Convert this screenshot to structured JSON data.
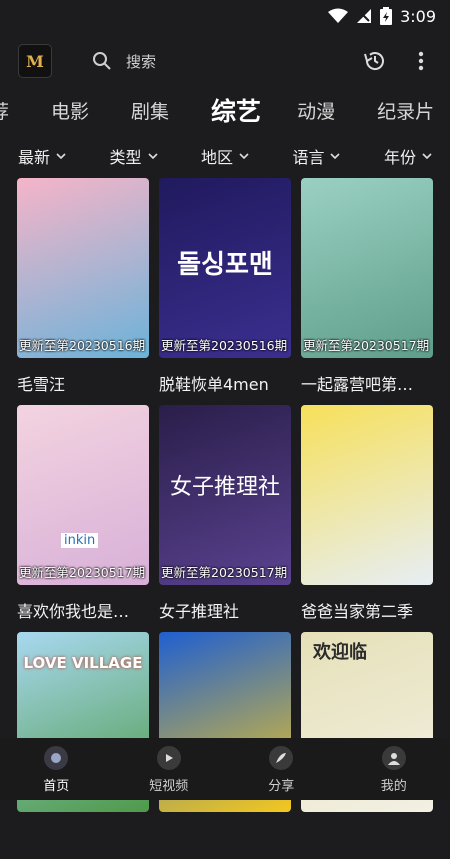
{
  "status_bar": {
    "time": "3:09"
  },
  "header": {
    "search_placeholder": "搜索",
    "logo_text": "M"
  },
  "tabs": [
    {
      "label": "荐"
    },
    {
      "label": "电影"
    },
    {
      "label": "剧集"
    },
    {
      "label": "综艺",
      "active": true
    },
    {
      "label": "动漫"
    },
    {
      "label": "纪录片"
    }
  ],
  "filters": [
    {
      "label": "最新"
    },
    {
      "label": "类型"
    },
    {
      "label": "地区"
    },
    {
      "label": "语言"
    },
    {
      "label": "年份"
    }
  ],
  "items": [
    {
      "title": "毛雪汪",
      "status": "更新至第20230516期",
      "colors": [
        "#f6b4c8",
        "#6bb3d9"
      ]
    },
    {
      "title": "脱鞋恢单4men",
      "status": "更新至第20230516期",
      "poster_text": "돌싱포맨",
      "colors": [
        "#201a5e",
        "#3b2f8f"
      ]
    },
    {
      "title": "一起露营吧第…",
      "status": "更新至第20230517期",
      "colors": [
        "#9ad0c2",
        "#5f9e8a"
      ]
    },
    {
      "title": "喜欢你我也是…",
      "status": "更新至第20230517期",
      "poster_text": "inkin",
      "colors": [
        "#f3d3e0",
        "#d8b0d8"
      ]
    },
    {
      "title": "女子推理社",
      "status": "更新至第20230517期",
      "poster_text": "女子推理社",
      "colors": [
        "#2a1e4a",
        "#5a4290"
      ]
    },
    {
      "title": "爸爸当家第二季",
      "status": "",
      "colors": [
        "#f7e05a",
        "#e6eef5"
      ]
    },
    {
      "title": "",
      "status": "",
      "poster_text": "LOVE VILLAGE",
      "colors": [
        "#a8d8f0",
        "#4e9a4a"
      ]
    },
    {
      "title": "",
      "status": "",
      "colors": [
        "#1f5fd0",
        "#f4c81d"
      ]
    },
    {
      "title": "",
      "status": "",
      "poster_text": "欢迎临",
      "colors": [
        "#e6e0b8",
        "#f2f0e2"
      ]
    }
  ],
  "bottom_nav": [
    {
      "label": "首页",
      "icon": "home-icon",
      "active": true
    },
    {
      "label": "短视频",
      "icon": "short-video-icon"
    },
    {
      "label": "分享",
      "icon": "share-icon"
    },
    {
      "label": "我的",
      "icon": "profile-icon"
    }
  ]
}
